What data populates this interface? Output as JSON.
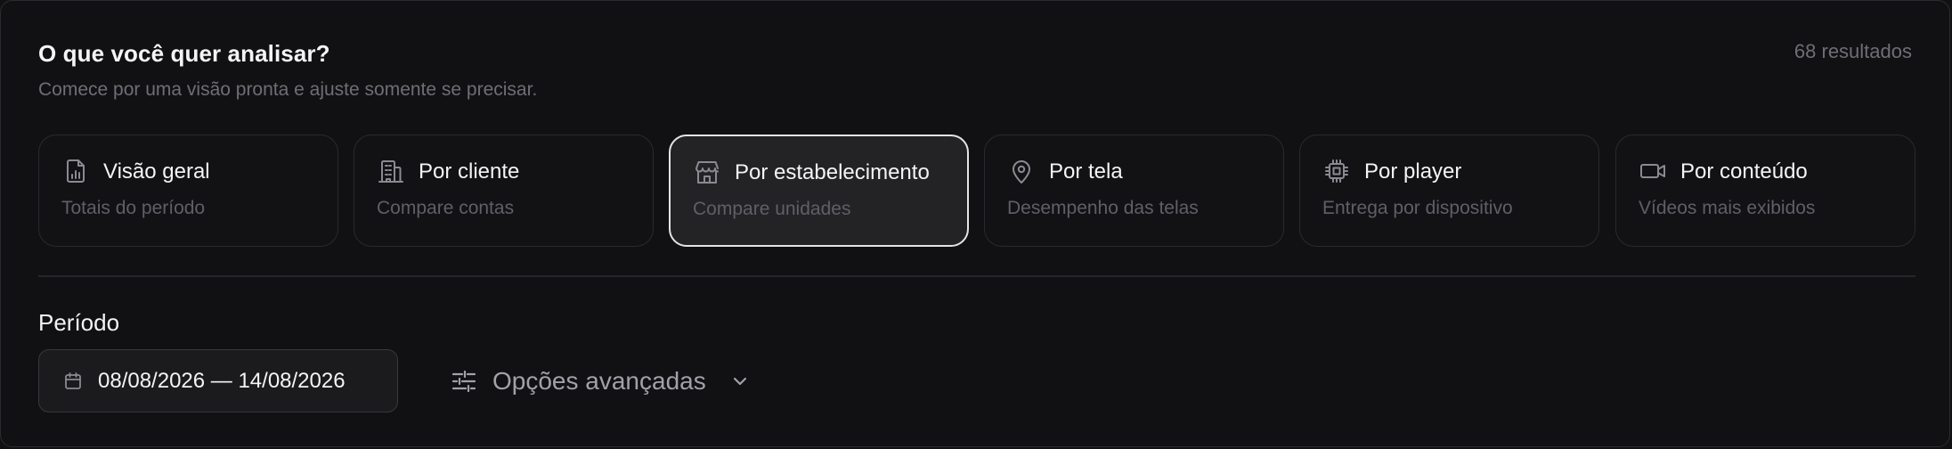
{
  "header": {
    "title": "O que você quer analisar?",
    "subtitle": "Comece por uma visão pronta e ajuste somente se precisar.",
    "results": "68 resultados"
  },
  "views": [
    {
      "title": "Visão geral",
      "description": "Totais do período",
      "icon": "bar-chart-file-icon",
      "active": false
    },
    {
      "title": "Por cliente",
      "description": "Compare contas",
      "icon": "building-icon",
      "active": false
    },
    {
      "title": "Por estabelecimento",
      "description": "Compare unidades",
      "icon": "store-icon",
      "active": true
    },
    {
      "title": "Por tela",
      "description": "Desempenho das telas",
      "icon": "map-pin-icon",
      "active": false
    },
    {
      "title": "Por player",
      "description": "Entrega por dispositivo",
      "icon": "chip-icon",
      "active": false
    },
    {
      "title": "Por conteúdo",
      "description": "Vídeos mais exibidos",
      "icon": "video-camera-icon",
      "active": false
    }
  ],
  "period": {
    "label": "Período",
    "range": "08/08/2026 — 14/08/2026",
    "icon": "calendar-icon"
  },
  "advanced": {
    "label": "Opções avançadas",
    "icon": "sliders-icon",
    "chevron": "chevron-down-icon"
  },
  "colors": {
    "background": "#111113",
    "active_card_bg": "#232326",
    "active_card_border": "#e4e4e7",
    "text_primary": "#f4f4f5",
    "text_muted": "#6e6e76"
  }
}
